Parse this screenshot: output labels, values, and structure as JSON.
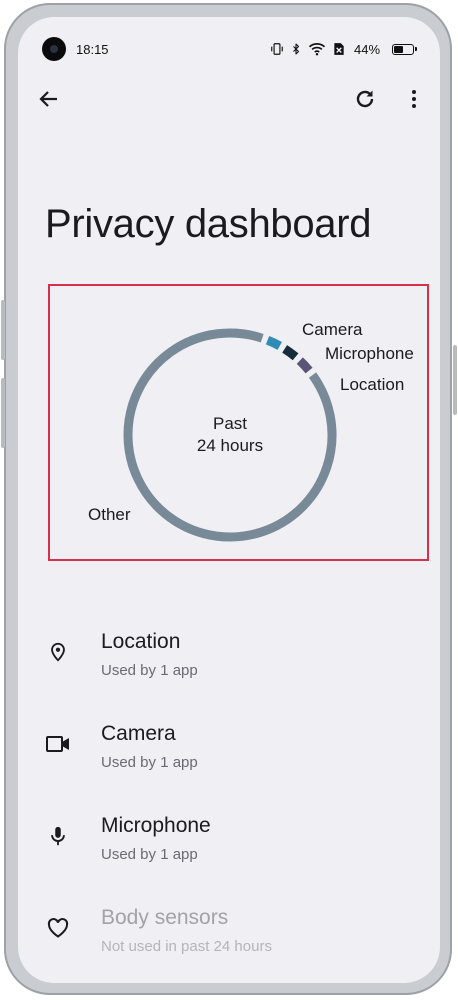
{
  "status_bar": {
    "time": "18:15",
    "battery_percent": "44%",
    "icons": [
      "vibrate-icon",
      "bluetooth-icon",
      "wifi-icon",
      "no-sim-icon",
      "battery-icon"
    ]
  },
  "toolbar": {
    "back_icon": "arrow-back-icon",
    "refresh_icon": "refresh-icon",
    "more_icon": "more-vert-icon"
  },
  "page": {
    "title": "Privacy dashboard"
  },
  "chart_data": {
    "type": "pie",
    "center_text": [
      "Past",
      "24 hours"
    ],
    "slices": [
      {
        "label": "Camera",
        "share": 0.03,
        "color": "#2e8cb5"
      },
      {
        "label": "Microphone",
        "share": 0.03,
        "color": "#142c3c"
      },
      {
        "label": "Location",
        "share": 0.03,
        "color": "#5a5578"
      },
      {
        "label": "Other",
        "share": 0.91,
        "color": "#788a97"
      }
    ]
  },
  "permissions": [
    {
      "title": "Location",
      "subtitle": "Used by 1 app",
      "icon": "location-pin-icon",
      "disabled": false
    },
    {
      "title": "Camera",
      "subtitle": "Used by 1 app",
      "icon": "videocam-icon",
      "disabled": false
    },
    {
      "title": "Microphone",
      "subtitle": "Used by 1 app",
      "icon": "microphone-icon",
      "disabled": false
    },
    {
      "title": "Body sensors",
      "subtitle": "Not used in past 24 hours",
      "icon": "heart-icon",
      "disabled": true
    }
  ]
}
